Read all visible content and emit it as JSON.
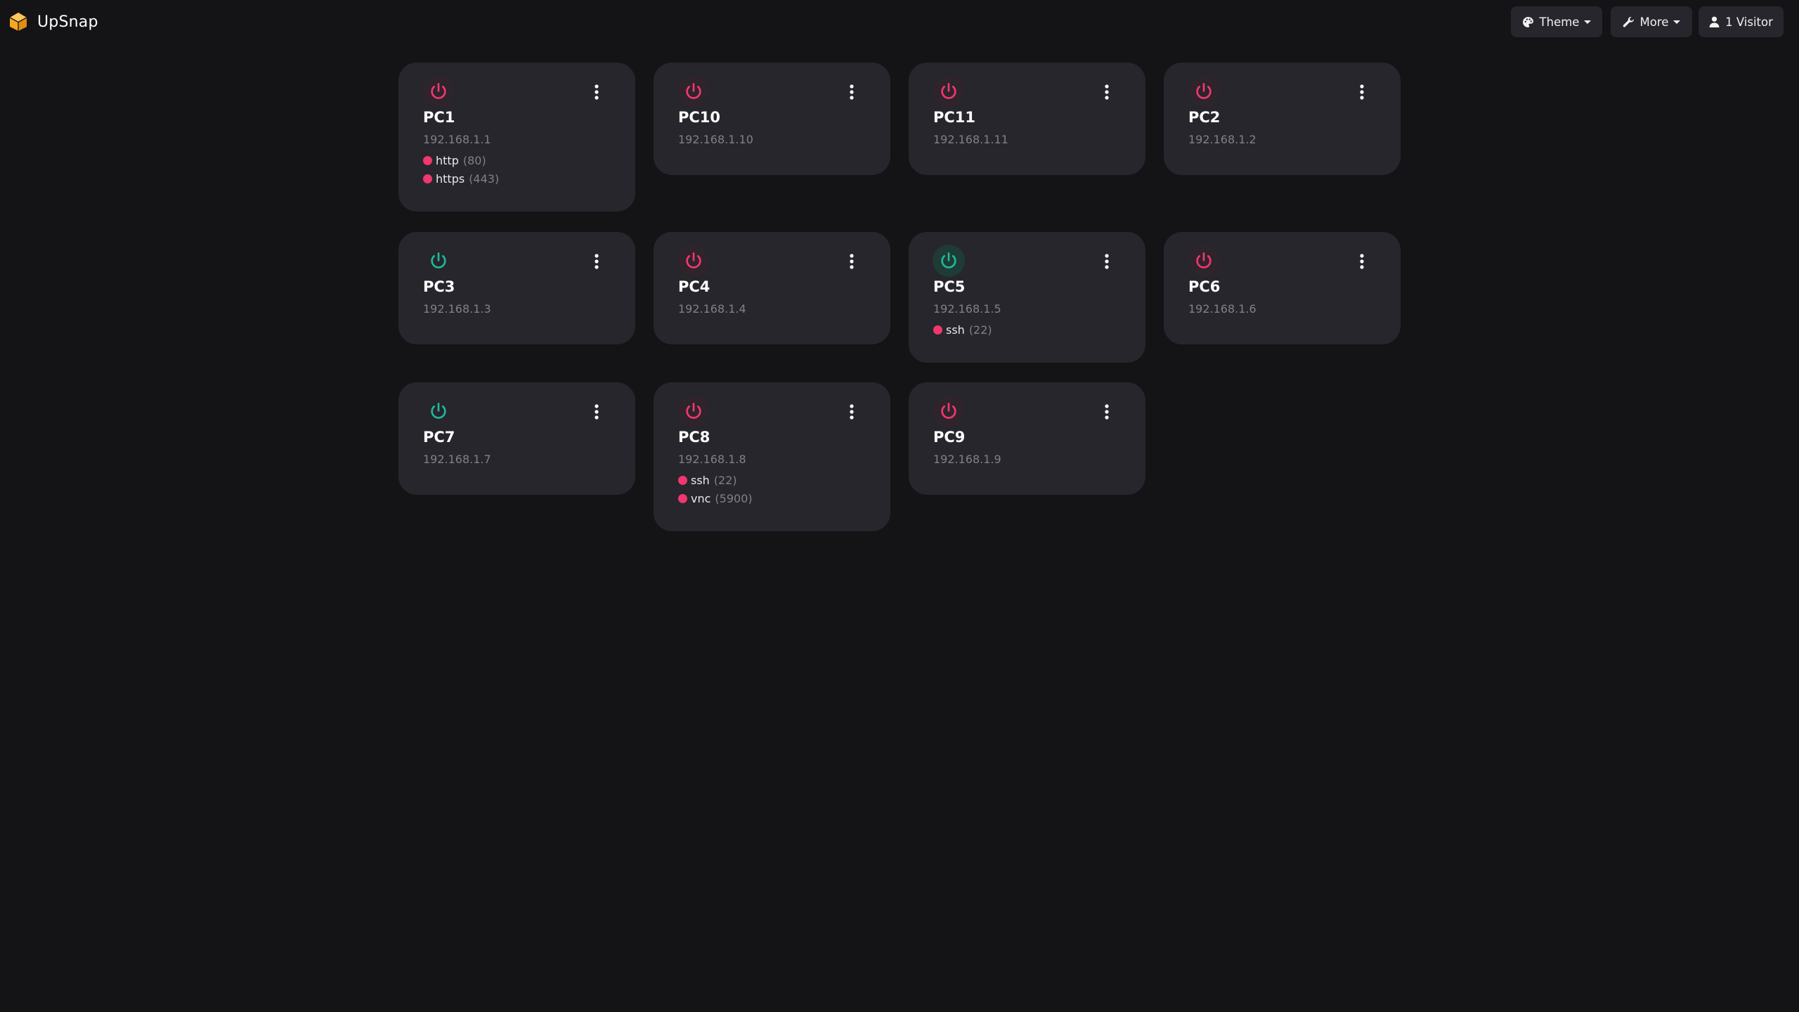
{
  "app": {
    "name": "UpSnap",
    "logo_icon": "upsnap-cube-logo"
  },
  "navbar": {
    "theme": {
      "label": "Theme",
      "icon": "palette-icon"
    },
    "more": {
      "label": "More",
      "icon": "wrench-icon"
    },
    "visitor": {
      "label": "1 Visitor",
      "icon": "user-icon"
    }
  },
  "colors": {
    "background": "#141417",
    "card": "#26262c",
    "online": "#1fb89a",
    "offline": "#f0376f",
    "muted_text": "#80808a",
    "logo": "#f6a623"
  },
  "devices": [
    {
      "name": "PC1",
      "ip": "192.168.1.1",
      "status": "offline",
      "ports": [
        {
          "name": "http",
          "number": "(80)",
          "status": "closed"
        },
        {
          "name": "https",
          "number": "(443)",
          "status": "closed"
        }
      ]
    },
    {
      "name": "PC10",
      "ip": "192.168.1.10",
      "status": "offline",
      "ports": []
    },
    {
      "name": "PC11",
      "ip": "192.168.1.11",
      "status": "offline",
      "ports": []
    },
    {
      "name": "PC2",
      "ip": "192.168.1.2",
      "status": "offline",
      "ports": []
    },
    {
      "name": "PC3",
      "ip": "192.168.1.3",
      "status": "online",
      "ports": []
    },
    {
      "name": "PC4",
      "ip": "192.168.1.4",
      "status": "offline",
      "ports": []
    },
    {
      "name": "PC5",
      "ip": "192.168.1.5",
      "status": "online",
      "ports": [
        {
          "name": "ssh",
          "number": "(22)",
          "status": "closed"
        }
      ]
    },
    {
      "name": "PC6",
      "ip": "192.168.1.6",
      "status": "offline",
      "ports": []
    },
    {
      "name": "PC7",
      "ip": "192.168.1.7",
      "status": "online",
      "ports": []
    },
    {
      "name": "PC8",
      "ip": "192.168.1.8",
      "status": "offline",
      "ports": [
        {
          "name": "ssh",
          "number": "(22)",
          "status": "closed"
        },
        {
          "name": "vnc",
          "number": "(5900)",
          "status": "closed"
        }
      ]
    },
    {
      "name": "PC9",
      "ip": "192.168.1.9",
      "status": "offline",
      "ports": []
    }
  ]
}
